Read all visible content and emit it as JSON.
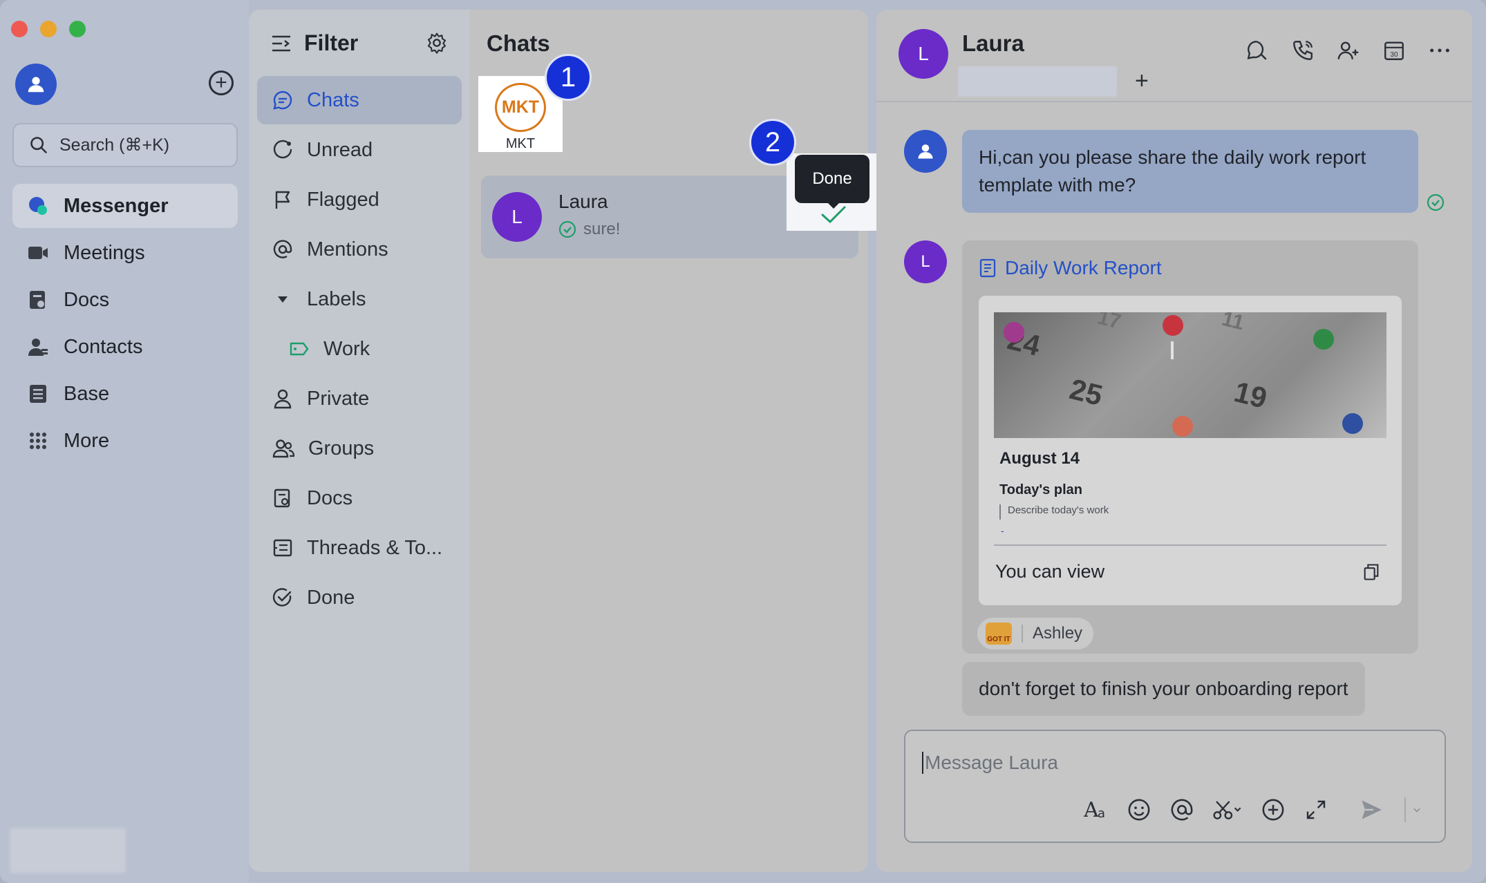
{
  "sidebar": {
    "search_placeholder": "Search (⌘+K)",
    "items": [
      {
        "label": "Messenger",
        "icon": "messenger-icon",
        "active": true
      },
      {
        "label": "Meetings",
        "icon": "video-camera-icon"
      },
      {
        "label": "Docs",
        "icon": "docs-icon"
      },
      {
        "label": "Contacts",
        "icon": "contacts-icon"
      },
      {
        "label": "Base",
        "icon": "base-icon"
      },
      {
        "label": "More",
        "icon": "grid-dots-icon"
      }
    ]
  },
  "filter": {
    "title": "Filter",
    "items": [
      {
        "label": "Chats",
        "active": true
      },
      {
        "label": "Unread"
      },
      {
        "label": "Flagged"
      },
      {
        "label": "Mentions"
      },
      {
        "label": "Labels"
      },
      {
        "label": "Work"
      },
      {
        "label": "Private"
      },
      {
        "label": "Groups"
      },
      {
        "label": "Docs"
      },
      {
        "label": "Threads & To..."
      },
      {
        "label": "Done"
      }
    ]
  },
  "chatlist": {
    "title": "Chats",
    "pinned": {
      "logo_text": "MKT",
      "label": "MKT"
    },
    "badges": [
      "1",
      "2"
    ],
    "row": {
      "avatar": "L",
      "name": "Laura",
      "preview": "sure!"
    },
    "tooltip": "Done"
  },
  "conversation": {
    "avatar": "L",
    "name": "Laura",
    "add_label": "+",
    "messages": {
      "first": "Hi,can you please share the daily work report template with me?",
      "doc_title": "Daily Work Report",
      "doc_date": "August 14",
      "doc_plan": "Today's plan",
      "doc_desc": "Describe today's work",
      "doc_dash": "-",
      "doc_permission": "You can view",
      "reaction_sticker": "GOT IT",
      "reaction_user": "Ashley",
      "last": "don't forget to finish your onboarding report"
    },
    "calendar_numbers": [
      "24",
      "25",
      "19",
      "17",
      "11"
    ],
    "input_placeholder": "Message Laura"
  },
  "colors": {
    "accent": "#2450c8",
    "badge": "#1630d8",
    "avatar_purple": "#6a2bc8",
    "avatar_blue": "#2f55c8",
    "success": "#1e9e6a",
    "mkt_orange": "#d9781a"
  }
}
